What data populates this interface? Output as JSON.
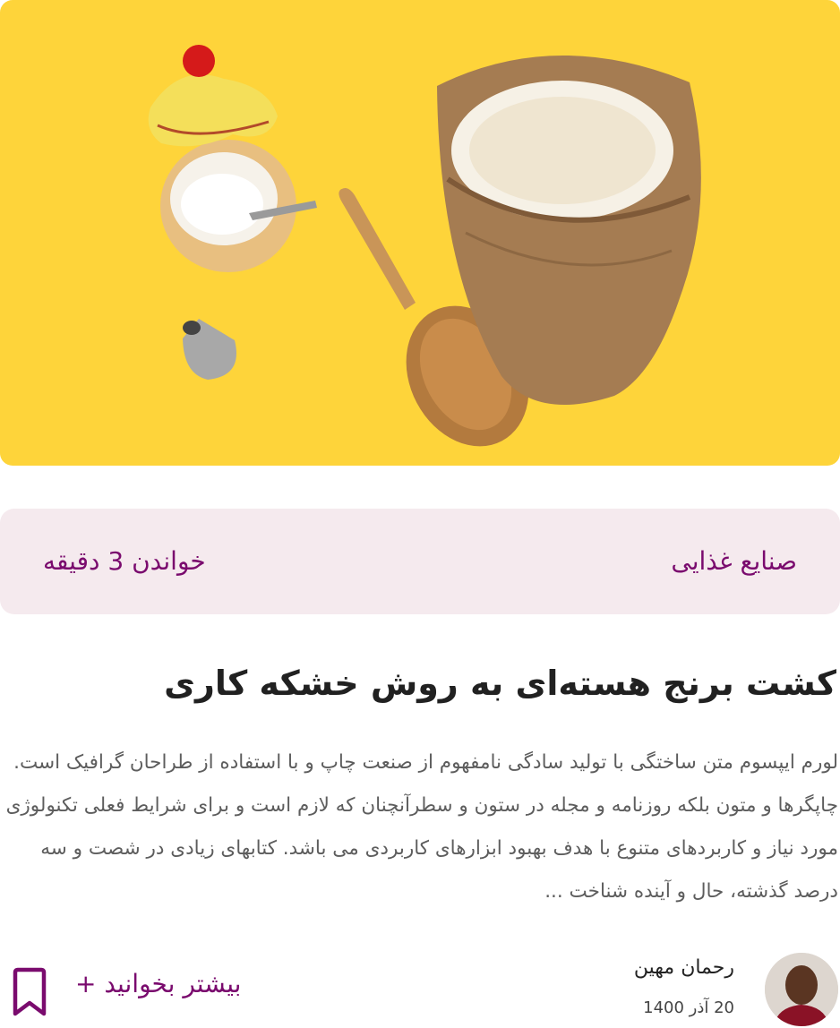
{
  "hero": {
    "icons": [
      "sugar-bowl-icon",
      "wooden-spoon-icon",
      "rice-sack-icon",
      "piping-tip-icon"
    ],
    "background_color": "#fed43a"
  },
  "meta": {
    "category": "صنایع غذایی",
    "read_time": "خواندن 3 دقیقه"
  },
  "article": {
    "title": "کشت برنج هسته‌ای به روش خشکه کاری",
    "excerpt": "لورم ایپسوم متن ساختگی با تولید سادگی نامفهوم از صنعت چاپ و با استفاده از طراحان گرافیک است. چاپگرها و متون بلکه روزنامه و مجله در ستون و سطرآنچنان که لازم است و برای شرایط فعلی تکنولوژی مورد نیاز و کاربردهای متنوع با هدف بهبود ابزارهای کاربردی می باشد. کتابهای زیادی در شصت و سه درصد گذشته، حال و آینده شناخت ..."
  },
  "author": {
    "name": "رحمان مهین",
    "date": "20 آذر 1400"
  },
  "actions": {
    "read_more_label": "بیشتر بخوانید +",
    "bookmark_icon": "bookmark-icon"
  },
  "colors": {
    "accent": "#7a0b6e",
    "meta_background": "#f5eaee"
  }
}
